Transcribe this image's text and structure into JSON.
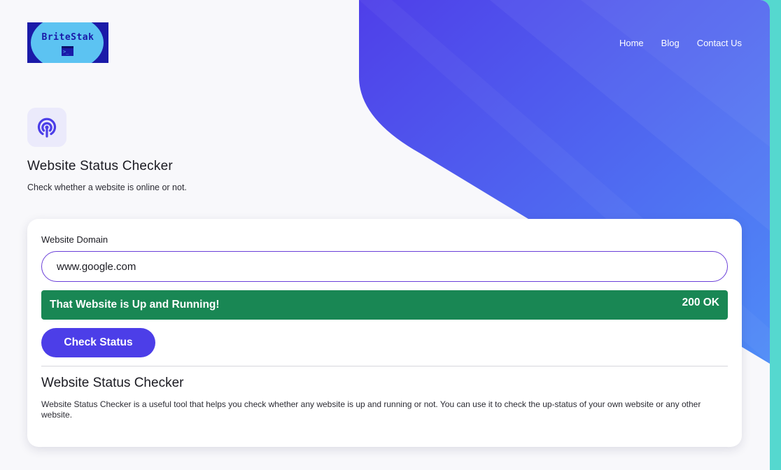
{
  "brand": {
    "logo_text": "BriteStak",
    "logo_glyph": ">_",
    "colors": {
      "logo_bg": "#1a1aa8",
      "logo_disc": "#5cc3f2"
    }
  },
  "nav": {
    "items": [
      {
        "label": "Home"
      },
      {
        "label": "Blog"
      },
      {
        "label": "Contact Us"
      }
    ]
  },
  "hero": {
    "icon": "broadcast-signal-icon",
    "title": "Website Status Checker",
    "subtitle": "Check whether a website is online or not."
  },
  "form": {
    "domain_label": "Website Domain",
    "domain_value": "www.google.com",
    "status_message": "That Website is Up and Running!",
    "status_code": "200 OK",
    "button_label": "Check Status"
  },
  "about": {
    "heading": "Website Status Checker",
    "text": "Website Status Checker is a useful tool that helps you check whether any website is up and running or not. You can use it to check the up-status of your own website or any other website."
  },
  "colors": {
    "accent": "#4c3ee8",
    "success": "#198754",
    "bg_gradient_start": "#4f3fe9",
    "bg_gradient_end": "#4f8cf7",
    "side_strip": "#55d8cf",
    "page_bg": "#f8f8fb"
  }
}
